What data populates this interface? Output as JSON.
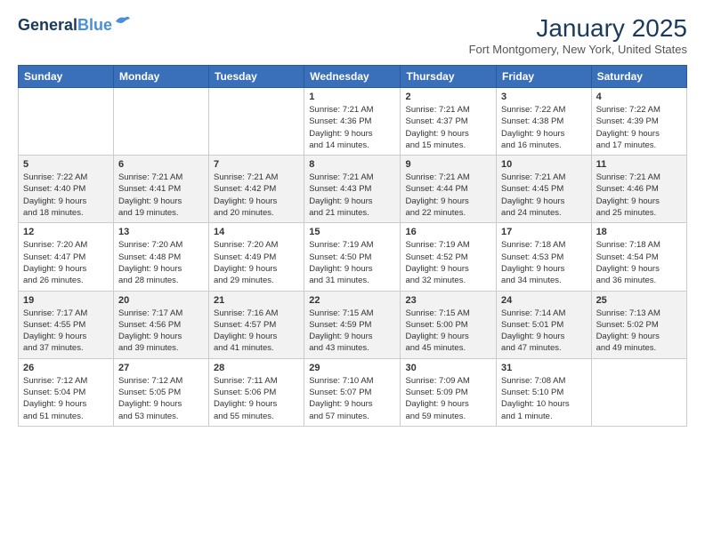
{
  "header": {
    "logo_line1": "General",
    "logo_line2": "Blue",
    "month": "January 2025",
    "location": "Fort Montgomery, New York, United States"
  },
  "days_of_week": [
    "Sunday",
    "Monday",
    "Tuesday",
    "Wednesday",
    "Thursday",
    "Friday",
    "Saturday"
  ],
  "weeks": [
    [
      {
        "num": "",
        "info": ""
      },
      {
        "num": "",
        "info": ""
      },
      {
        "num": "",
        "info": ""
      },
      {
        "num": "1",
        "info": "Sunrise: 7:21 AM\nSunset: 4:36 PM\nDaylight: 9 hours\nand 14 minutes."
      },
      {
        "num": "2",
        "info": "Sunrise: 7:21 AM\nSunset: 4:37 PM\nDaylight: 9 hours\nand 15 minutes."
      },
      {
        "num": "3",
        "info": "Sunrise: 7:22 AM\nSunset: 4:38 PM\nDaylight: 9 hours\nand 16 minutes."
      },
      {
        "num": "4",
        "info": "Sunrise: 7:22 AM\nSunset: 4:39 PM\nDaylight: 9 hours\nand 17 minutes."
      }
    ],
    [
      {
        "num": "5",
        "info": "Sunrise: 7:22 AM\nSunset: 4:40 PM\nDaylight: 9 hours\nand 18 minutes."
      },
      {
        "num": "6",
        "info": "Sunrise: 7:21 AM\nSunset: 4:41 PM\nDaylight: 9 hours\nand 19 minutes."
      },
      {
        "num": "7",
        "info": "Sunrise: 7:21 AM\nSunset: 4:42 PM\nDaylight: 9 hours\nand 20 minutes."
      },
      {
        "num": "8",
        "info": "Sunrise: 7:21 AM\nSunset: 4:43 PM\nDaylight: 9 hours\nand 21 minutes."
      },
      {
        "num": "9",
        "info": "Sunrise: 7:21 AM\nSunset: 4:44 PM\nDaylight: 9 hours\nand 22 minutes."
      },
      {
        "num": "10",
        "info": "Sunrise: 7:21 AM\nSunset: 4:45 PM\nDaylight: 9 hours\nand 24 minutes."
      },
      {
        "num": "11",
        "info": "Sunrise: 7:21 AM\nSunset: 4:46 PM\nDaylight: 9 hours\nand 25 minutes."
      }
    ],
    [
      {
        "num": "12",
        "info": "Sunrise: 7:20 AM\nSunset: 4:47 PM\nDaylight: 9 hours\nand 26 minutes."
      },
      {
        "num": "13",
        "info": "Sunrise: 7:20 AM\nSunset: 4:48 PM\nDaylight: 9 hours\nand 28 minutes."
      },
      {
        "num": "14",
        "info": "Sunrise: 7:20 AM\nSunset: 4:49 PM\nDaylight: 9 hours\nand 29 minutes."
      },
      {
        "num": "15",
        "info": "Sunrise: 7:19 AM\nSunset: 4:50 PM\nDaylight: 9 hours\nand 31 minutes."
      },
      {
        "num": "16",
        "info": "Sunrise: 7:19 AM\nSunset: 4:52 PM\nDaylight: 9 hours\nand 32 minutes."
      },
      {
        "num": "17",
        "info": "Sunrise: 7:18 AM\nSunset: 4:53 PM\nDaylight: 9 hours\nand 34 minutes."
      },
      {
        "num": "18",
        "info": "Sunrise: 7:18 AM\nSunset: 4:54 PM\nDaylight: 9 hours\nand 36 minutes."
      }
    ],
    [
      {
        "num": "19",
        "info": "Sunrise: 7:17 AM\nSunset: 4:55 PM\nDaylight: 9 hours\nand 37 minutes."
      },
      {
        "num": "20",
        "info": "Sunrise: 7:17 AM\nSunset: 4:56 PM\nDaylight: 9 hours\nand 39 minutes."
      },
      {
        "num": "21",
        "info": "Sunrise: 7:16 AM\nSunset: 4:57 PM\nDaylight: 9 hours\nand 41 minutes."
      },
      {
        "num": "22",
        "info": "Sunrise: 7:15 AM\nSunset: 4:59 PM\nDaylight: 9 hours\nand 43 minutes."
      },
      {
        "num": "23",
        "info": "Sunrise: 7:15 AM\nSunset: 5:00 PM\nDaylight: 9 hours\nand 45 minutes."
      },
      {
        "num": "24",
        "info": "Sunrise: 7:14 AM\nSunset: 5:01 PM\nDaylight: 9 hours\nand 47 minutes."
      },
      {
        "num": "25",
        "info": "Sunrise: 7:13 AM\nSunset: 5:02 PM\nDaylight: 9 hours\nand 49 minutes."
      }
    ],
    [
      {
        "num": "26",
        "info": "Sunrise: 7:12 AM\nSunset: 5:04 PM\nDaylight: 9 hours\nand 51 minutes."
      },
      {
        "num": "27",
        "info": "Sunrise: 7:12 AM\nSunset: 5:05 PM\nDaylight: 9 hours\nand 53 minutes."
      },
      {
        "num": "28",
        "info": "Sunrise: 7:11 AM\nSunset: 5:06 PM\nDaylight: 9 hours\nand 55 minutes."
      },
      {
        "num": "29",
        "info": "Sunrise: 7:10 AM\nSunset: 5:07 PM\nDaylight: 9 hours\nand 57 minutes."
      },
      {
        "num": "30",
        "info": "Sunrise: 7:09 AM\nSunset: 5:09 PM\nDaylight: 9 hours\nand 59 minutes."
      },
      {
        "num": "31",
        "info": "Sunrise: 7:08 AM\nSunset: 5:10 PM\nDaylight: 10 hours\nand 1 minute."
      },
      {
        "num": "",
        "info": ""
      }
    ]
  ]
}
